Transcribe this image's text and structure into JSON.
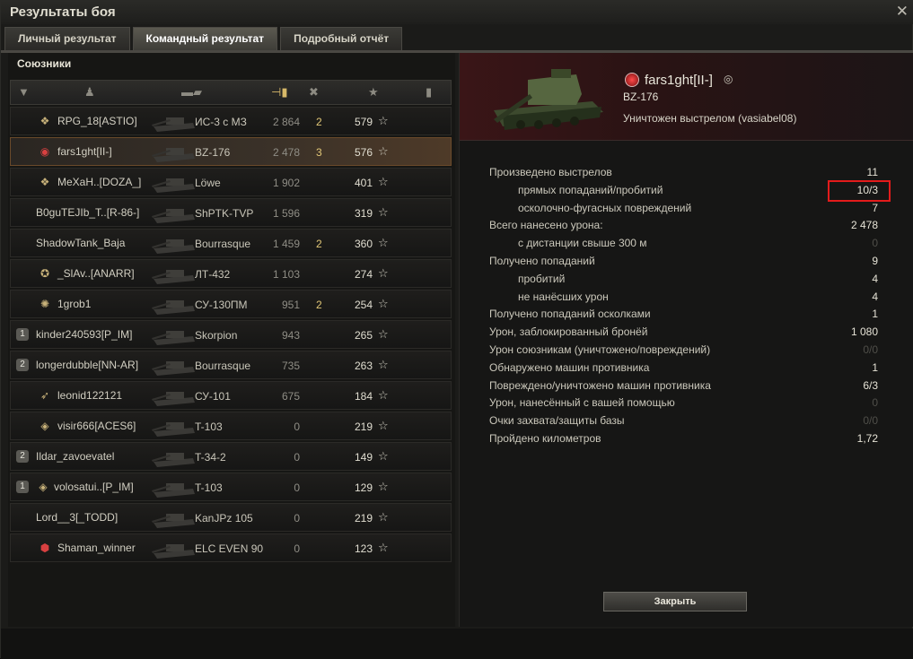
{
  "window": {
    "title": "Результаты боя"
  },
  "tabs": [
    "Личный результат",
    "Командный результат",
    "Подробный отчёт"
  ],
  "active_tab": 1,
  "allies": {
    "title": "Союзники",
    "rows": [
      {
        "rank": "",
        "clan": "clan-emblem-icon",
        "name": "RPG_18[ASTIO]",
        "tank": "ИС-3 с МЗ",
        "damage": "2 864",
        "kills": "2",
        "xp": "579",
        "me": false
      },
      {
        "rank": "",
        "clan": "red-emblem-icon",
        "name": "fars1ght[II-]",
        "tank": "BZ-176",
        "damage": "2 478",
        "kills": "3",
        "xp": "576",
        "me": true
      },
      {
        "rank": "",
        "clan": "clan-emblem-icon",
        "name": "MeXaH..[DOZA_]",
        "tank": "Löwe",
        "damage": "1 902",
        "kills": "",
        "xp": "401",
        "me": false
      },
      {
        "rank": "",
        "clan": "",
        "name": "B0guTEJIb_T..[R-86-]",
        "tank": "ShPTK-TVP",
        "damage": "1 596",
        "kills": "",
        "xp": "319",
        "me": false
      },
      {
        "rank": "",
        "clan": "",
        "name": "ShadowTank_Baja",
        "tank": "Bourrasque",
        "damage": "1 459",
        "kills": "2",
        "xp": "360",
        "me": false
      },
      {
        "rank": "",
        "clan": "star-emblem-icon",
        "name": "_SlAv..[ANARR]",
        "tank": "ЛТ-432",
        "damage": "1 103",
        "kills": "",
        "xp": "274",
        "me": false
      },
      {
        "rank": "",
        "clan": "snowflake-emblem-icon",
        "name": "1grob1",
        "tank": "СУ-130ПМ",
        "damage": "951",
        "kills": "2",
        "xp": "254",
        "me": false
      },
      {
        "rank": "1",
        "clan": "",
        "name": "kinder240593[P_IM]",
        "tank": "Skorpion",
        "damage": "943",
        "kills": "",
        "xp": "265",
        "me": false
      },
      {
        "rank": "2",
        "clan": "",
        "name": "longerdubble[NN-AR]",
        "tank": "Bourrasque",
        "damage": "735",
        "kills": "",
        "xp": "263",
        "me": false
      },
      {
        "rank": "",
        "clan": "wing-emblem-icon",
        "name": "leonid122121",
        "tank": "СУ-101",
        "damage": "675",
        "kills": "",
        "xp": "184",
        "me": false
      },
      {
        "rank": "",
        "clan": "diamond-emblem-icon",
        "name": "visir666[ACES6]",
        "tank": "T-103",
        "damage": "0",
        "kills": "",
        "xp": "219",
        "me": false
      },
      {
        "rank": "2",
        "clan": "",
        "name": "Ildar_zavoevatel",
        "tank": "T-34-2",
        "damage": "0",
        "kills": "",
        "xp": "149",
        "me": false
      },
      {
        "rank": "1",
        "clan": "diamond-emblem-icon",
        "name": "volosatui..[P_IM]",
        "tank": "T-103",
        "damage": "0",
        "kills": "",
        "xp": "129",
        "me": false
      },
      {
        "rank": "",
        "clan": "",
        "name": "Lord__3[_TODD]",
        "tank": "KanJPz 105",
        "damage": "0",
        "kills": "",
        "xp": "219",
        "me": false
      },
      {
        "rank": "",
        "clan": "red-shield-emblem-icon",
        "name": "Shaman_winner",
        "tank": "ELC EVEN 90",
        "damage": "0",
        "kills": "",
        "xp": "123",
        "me": false
      }
    ]
  },
  "detail": {
    "player": "fars1ght[II-]",
    "vehicle": "BZ-176",
    "status": "Уничтожен выстрелом (vasiabel08)",
    "stats": [
      {
        "label": "Произведено выстрелов",
        "value": "11",
        "indent": false,
        "dim": false
      },
      {
        "label": "прямых попаданий/пробитий",
        "value": "10/3",
        "indent": true,
        "dim": false
      },
      {
        "label": "осколочно-фугасных повреждений",
        "value": "7",
        "indent": true,
        "dim": false
      },
      {
        "label": "Всего нанесено урона:",
        "value": "2 478",
        "indent": false,
        "dim": false
      },
      {
        "label": "с дистанции свыше 300 м",
        "value": "0",
        "indent": true,
        "dim": true
      },
      {
        "label": "Получено попаданий",
        "value": "9",
        "indent": false,
        "dim": false
      },
      {
        "label": "пробитий",
        "value": "4",
        "indent": true,
        "dim": false
      },
      {
        "label": "не нанёсших урон",
        "value": "4",
        "indent": true,
        "dim": false
      },
      {
        "label": "Получено попаданий осколками",
        "value": "1",
        "indent": false,
        "dim": false
      },
      {
        "label": "Урон, заблокированный бронёй",
        "value": "1 080",
        "indent": false,
        "dim": false
      },
      {
        "label": "Урон союзникам (уничтожено/повреждений)",
        "value": "0/0",
        "indent": false,
        "dim": true
      },
      {
        "label": "Обнаружено машин противника",
        "value": "1",
        "indent": false,
        "dim": false
      },
      {
        "label": "Повреждено/уничтожено машин противника",
        "value": "6/3",
        "indent": false,
        "dim": false
      },
      {
        "label": "Урон, нанесённый с вашей помощью",
        "value": "0",
        "indent": false,
        "dim": true
      },
      {
        "label": "Очки захвата/защиты базы",
        "value": "0/0",
        "indent": false,
        "dim": true
      },
      {
        "label": "Пройдено километров",
        "value": "1,72",
        "indent": false,
        "dim": false
      }
    ],
    "close_label": "Закрыть"
  },
  "colors": {
    "accent_gold": "#d7b969",
    "highlight_red": "#e31b1b"
  }
}
